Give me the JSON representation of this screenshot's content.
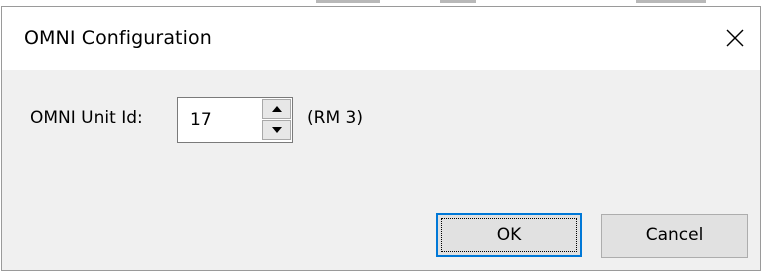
{
  "dialog": {
    "title": "OMNI Configuration",
    "close_icon": "close-icon"
  },
  "form": {
    "unit_id_label": "OMNI Unit Id:",
    "unit_id_value": "17",
    "unit_note": "(RM 3)",
    "spin_up_icon": "chevron-up-icon",
    "spin_down_icon": "chevron-down-icon"
  },
  "buttons": {
    "ok_label": "OK",
    "cancel_label": "Cancel"
  },
  "colors": {
    "dialog_background": "#f0f0f0",
    "titlebar_background": "#ffffff",
    "focus_accent": "#0078d7",
    "button_face": "#e1e1e1"
  }
}
